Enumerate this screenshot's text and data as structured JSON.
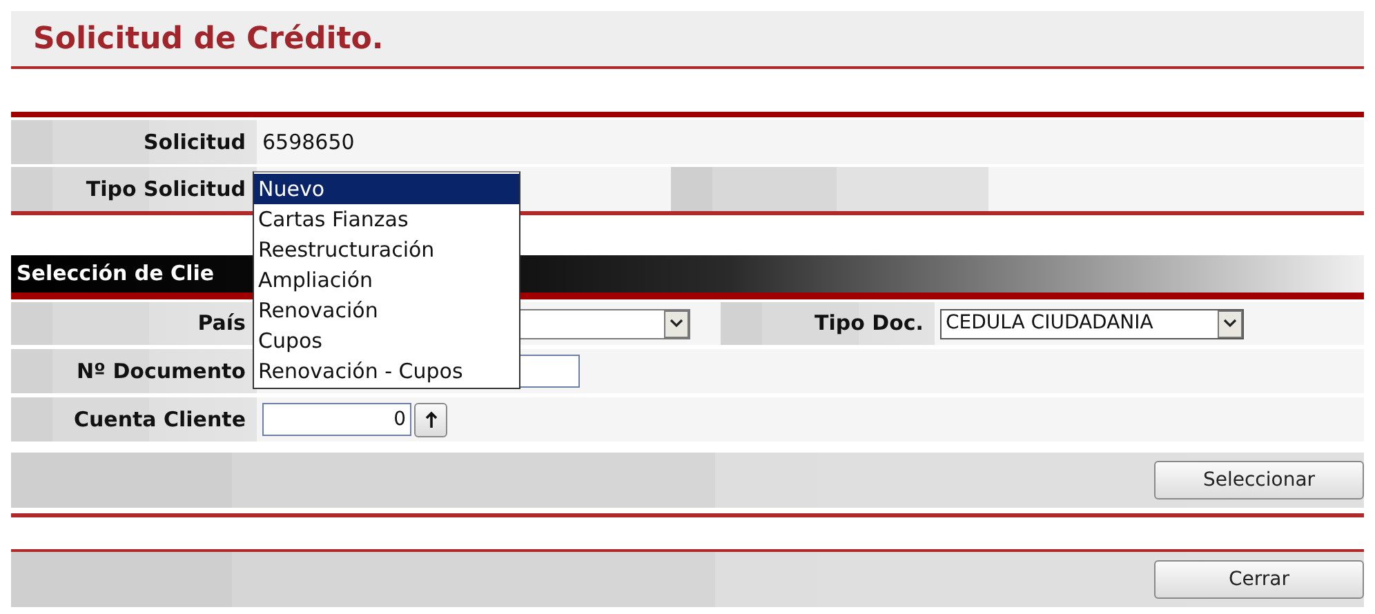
{
  "title": "Solicitud de Crédito.",
  "request": {
    "number_label": "Solicitud",
    "number": "6598650",
    "type_label": "Tipo Solicitud",
    "type_options": [
      {
        "label": "Nuevo",
        "selected": true
      },
      {
        "label": "Cartas Fianzas",
        "selected": false
      },
      {
        "label": "Reestructuración",
        "selected": false
      },
      {
        "label": "Ampliación",
        "selected": false
      },
      {
        "label": "Renovación",
        "selected": false
      },
      {
        "label": "Cupos",
        "selected": false
      },
      {
        "label": "Renovación - Cupos",
        "selected": false
      }
    ]
  },
  "client_section": {
    "title": "Selección de Clie",
    "country_label": "País",
    "doc_type_label": "Tipo Doc.",
    "doc_type": "CEDULA CIUDADANIA",
    "doc_number_label": "Nº Documento",
    "account_label": "Cuenta Cliente",
    "account": "0",
    "button": "Seleccionar"
  },
  "close_button": "Cerrar"
}
